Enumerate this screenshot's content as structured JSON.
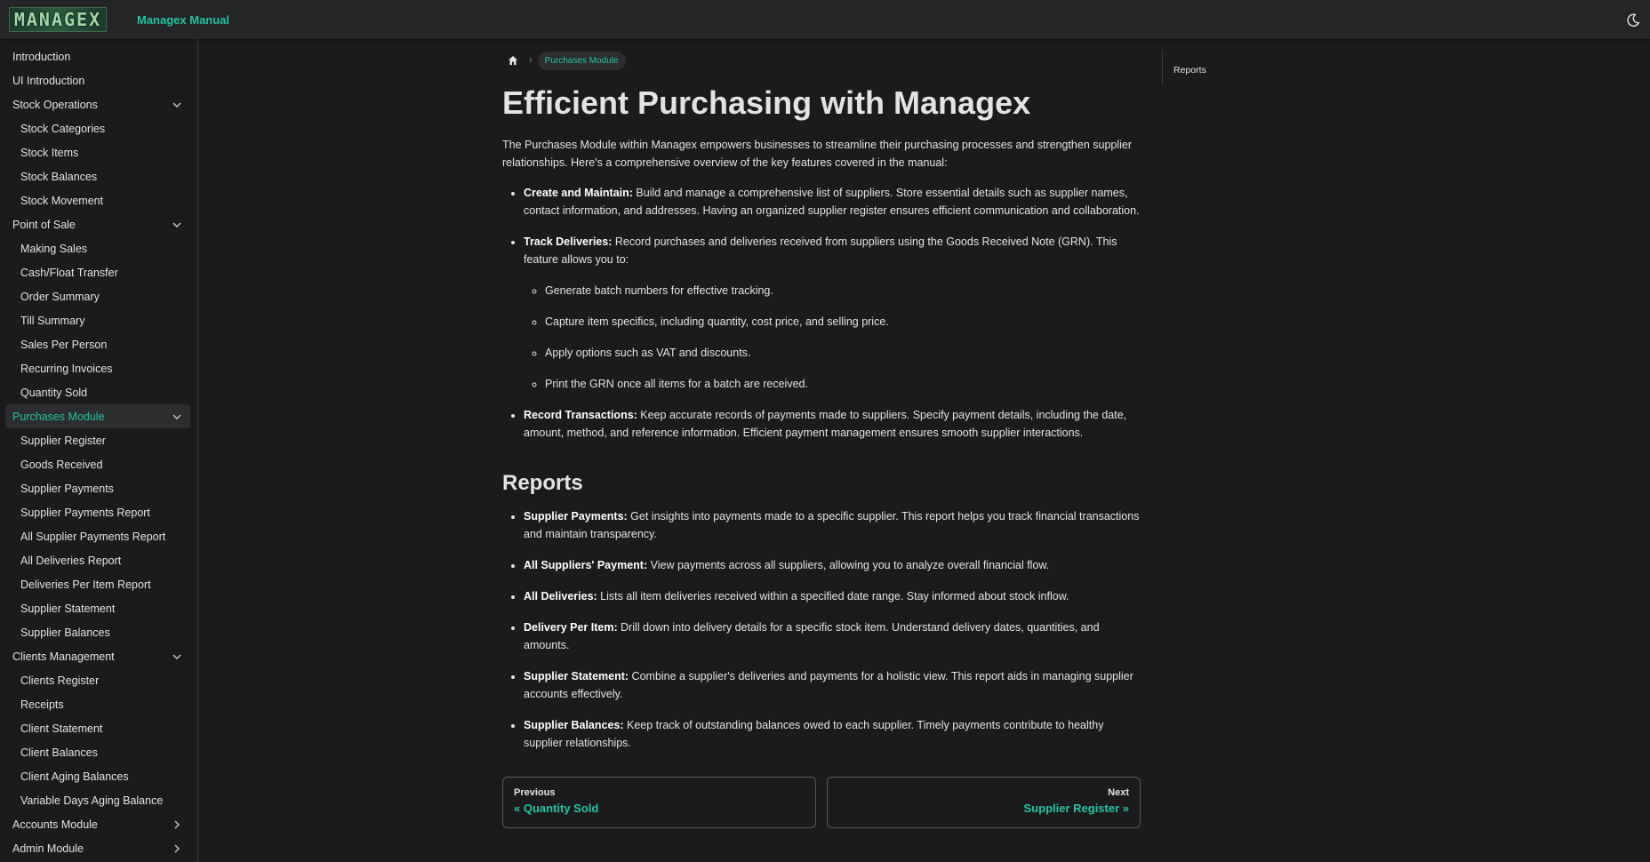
{
  "navbar": {
    "logo_text": "MANAGEX",
    "title": "Managex Manual",
    "theme_icon": "moon-icon"
  },
  "sidebar": {
    "items": [
      {
        "label": "Introduction",
        "level": 0,
        "chevron": null,
        "active": false
      },
      {
        "label": "UI Introduction",
        "level": 0,
        "chevron": null,
        "active": false
      },
      {
        "label": "Stock Operations",
        "level": 0,
        "chevron": "down",
        "active": false
      },
      {
        "label": "Stock Categories",
        "level": 1,
        "chevron": null,
        "active": false
      },
      {
        "label": "Stock Items",
        "level": 1,
        "chevron": null,
        "active": false
      },
      {
        "label": "Stock Balances",
        "level": 1,
        "chevron": null,
        "active": false
      },
      {
        "label": "Stock Movement",
        "level": 1,
        "chevron": null,
        "active": false
      },
      {
        "label": "Point of Sale",
        "level": 0,
        "chevron": "down",
        "active": false
      },
      {
        "label": "Making Sales",
        "level": 1,
        "chevron": null,
        "active": false
      },
      {
        "label": "Cash/Float Transfer",
        "level": 1,
        "chevron": null,
        "active": false
      },
      {
        "label": "Order Summary",
        "level": 1,
        "chevron": null,
        "active": false
      },
      {
        "label": "Till Summary",
        "level": 1,
        "chevron": null,
        "active": false
      },
      {
        "label": "Sales Per Person",
        "level": 1,
        "chevron": null,
        "active": false
      },
      {
        "label": "Recurring Invoices",
        "level": 1,
        "chevron": null,
        "active": false
      },
      {
        "label": "Quantity Sold",
        "level": 1,
        "chevron": null,
        "active": false
      },
      {
        "label": "Purchases Module",
        "level": 0,
        "chevron": "down",
        "active": true
      },
      {
        "label": "Supplier Register",
        "level": 1,
        "chevron": null,
        "active": false
      },
      {
        "label": "Goods Received",
        "level": 1,
        "chevron": null,
        "active": false
      },
      {
        "label": "Supplier Payments",
        "level": 1,
        "chevron": null,
        "active": false
      },
      {
        "label": "Supplier Payments Report",
        "level": 1,
        "chevron": null,
        "active": false
      },
      {
        "label": "All Supplier Payments Report",
        "level": 1,
        "chevron": null,
        "active": false
      },
      {
        "label": "All Deliveries Report",
        "level": 1,
        "chevron": null,
        "active": false
      },
      {
        "label": "Deliveries Per Item Report",
        "level": 1,
        "chevron": null,
        "active": false
      },
      {
        "label": "Supplier Statement",
        "level": 1,
        "chevron": null,
        "active": false
      },
      {
        "label": "Supplier Balances",
        "level": 1,
        "chevron": null,
        "active": false
      },
      {
        "label": "Clients Management",
        "level": 0,
        "chevron": "down",
        "active": false
      },
      {
        "label": "Clients Register",
        "level": 1,
        "chevron": null,
        "active": false
      },
      {
        "label": "Receipts",
        "level": 1,
        "chevron": null,
        "active": false
      },
      {
        "label": "Client Statement",
        "level": 1,
        "chevron": null,
        "active": false
      },
      {
        "label": "Client Balances",
        "level": 1,
        "chevron": null,
        "active": false
      },
      {
        "label": "Client Aging Balances",
        "level": 1,
        "chevron": null,
        "active": false
      },
      {
        "label": "Variable Days Aging Balance",
        "level": 1,
        "chevron": null,
        "active": false
      },
      {
        "label": "Accounts Module",
        "level": 0,
        "chevron": "right",
        "active": false
      },
      {
        "label": "Admin Module",
        "level": 0,
        "chevron": "right",
        "active": false
      }
    ]
  },
  "breadcrumb": {
    "home_icon": "home-icon",
    "current": "Purchases Module"
  },
  "content": {
    "title": "Efficient Purchasing with Managex",
    "intro": "The Purchases Module within Managex empowers businesses to streamline their purchasing processes and strengthen supplier relationships. Here's a comprehensive overview of the key features covered in the manual:",
    "features": [
      {
        "term": "Create and Maintain:",
        "text": " Build and manage a comprehensive list of suppliers. Store essential details such as supplier names, contact information, and addresses. Having an organized supplier register ensures efficient communication and collaboration."
      },
      {
        "term": "Track Deliveries:",
        "text": " Record purchases and deliveries received from suppliers using the Goods Received Note (GRN). This feature allows you to:"
      },
      {
        "term": "Record Transactions:",
        "text": " Keep accurate records of payments made to suppliers. Specify payment details, including the date, amount, method, and reference information. Efficient payment management ensures smooth supplier interactions."
      }
    ],
    "deliveries_sub": [
      "Generate batch numbers for effective tracking.",
      "Capture item specifics, including quantity, cost price, and selling price.",
      "Apply options such as VAT and discounts.",
      "Print the GRN once all items for a batch are received."
    ],
    "reports_heading": "Reports",
    "reports": [
      {
        "term": "Supplier Payments:",
        "text": " Get insights into payments made to a specific supplier. This report helps you track financial transactions and maintain transparency."
      },
      {
        "term": "All Suppliers' Payment:",
        "text": " View payments across all suppliers, allowing you to analyze overall financial flow."
      },
      {
        "term": "All Deliveries:",
        "text": " Lists all item deliveries received within a specified date range. Stay informed about stock inflow."
      },
      {
        "term": "Delivery Per Item:",
        "text": " Drill down into delivery details for a specific stock item. Understand delivery dates, quantities, and amounts."
      },
      {
        "term": "Supplier Statement:",
        "text": " Combine a supplier's deliveries and payments for a holistic view. This report aids in managing supplier accounts effectively."
      },
      {
        "term": "Supplier Balances:",
        "text": " Keep track of outstanding balances owed to each supplier. Timely payments contribute to healthy supplier relationships."
      }
    ]
  },
  "pager": {
    "previous_sub": "Previous",
    "previous_label": "« Quantity Sold",
    "next_sub": "Next",
    "next_label": "Supplier Register »"
  },
  "toc": {
    "items": [
      "Reports"
    ]
  },
  "colors": {
    "accent": "#25c2a0",
    "background": "#1b1b1d",
    "navbar": "#242526"
  }
}
